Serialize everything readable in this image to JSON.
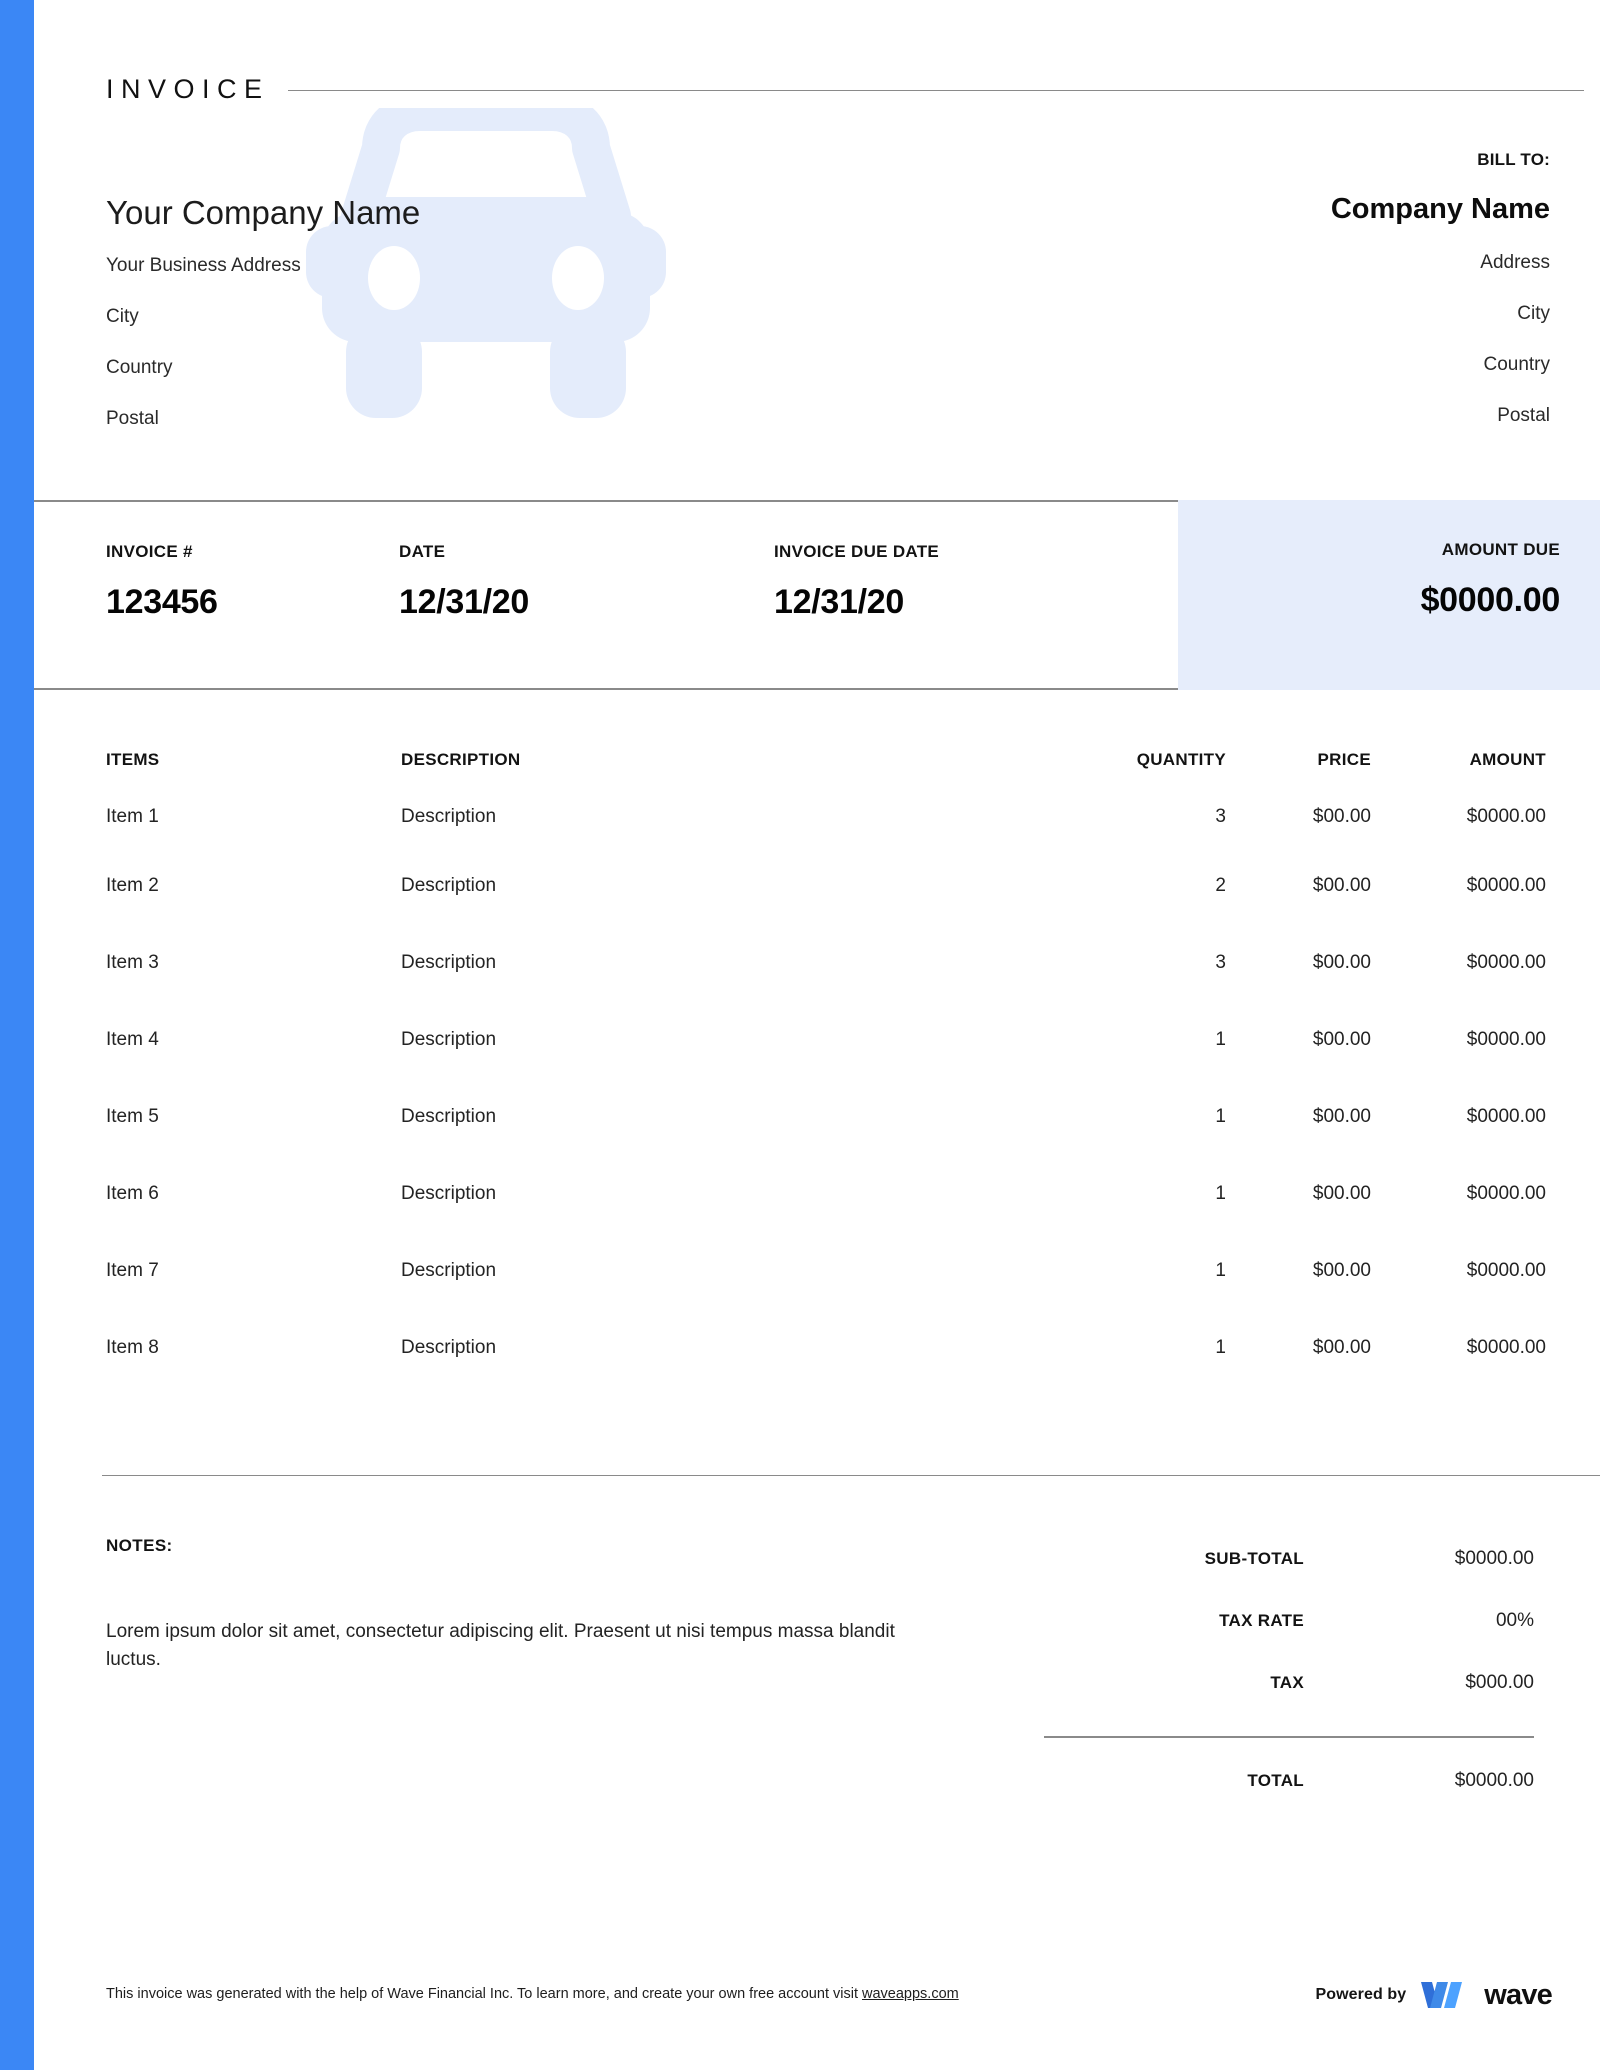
{
  "document": {
    "title": "INVOICE"
  },
  "sender": {
    "company_name": "Your Company Name",
    "address_lines": [
      "Your Business Address",
      "City",
      "Country",
      "Postal"
    ]
  },
  "bill_to": {
    "label": "BILL TO:",
    "company_name": "Company Name",
    "address_lines": [
      "Address",
      "City",
      "Country",
      "Postal"
    ]
  },
  "meta": {
    "invoice_number_label": "INVOICE #",
    "invoice_number": "123456",
    "date_label": "DATE",
    "date": "12/31/20",
    "due_date_label": "INVOICE DUE DATE",
    "due_date": "12/31/20",
    "amount_due_label": "AMOUNT DUE",
    "amount_due": "$0000.00"
  },
  "items_table": {
    "headers": [
      "ITEMS",
      "DESCRIPTION",
      "QUANTITY",
      "PRICE",
      "AMOUNT"
    ],
    "rows": [
      {
        "item": "Item 1",
        "description": "Description",
        "quantity": "3",
        "price": "$00.00",
        "amount": "$0000.00"
      },
      {
        "item": "Item 2",
        "description": "Description",
        "quantity": "2",
        "price": "$00.00",
        "amount": "$0000.00"
      },
      {
        "item": "Item 3",
        "description": "Description",
        "quantity": "3",
        "price": "$00.00",
        "amount": "$0000.00"
      },
      {
        "item": "Item 4",
        "description": "Description",
        "quantity": "1",
        "price": "$00.00",
        "amount": "$0000.00"
      },
      {
        "item": "Item 5",
        "description": "Description",
        "quantity": "1",
        "price": "$00.00",
        "amount": "$0000.00"
      },
      {
        "item": "Item 6",
        "description": "Description",
        "quantity": "1",
        "price": "$00.00",
        "amount": "$0000.00"
      },
      {
        "item": "Item 7",
        "description": "Description",
        "quantity": "1",
        "price": "$00.00",
        "amount": "$0000.00"
      },
      {
        "item": "Item 8",
        "description": "Description",
        "quantity": "1",
        "price": "$00.00",
        "amount": "$0000.00"
      }
    ]
  },
  "notes": {
    "label": "NOTES:",
    "text": "Lorem ipsum dolor sit amet, consectetur adipiscing elit. Praesent ut nisi tempus massa blandit luctus."
  },
  "totals": {
    "subtotal_label": "SUB-TOTAL",
    "subtotal_value": "$0000.00",
    "tax_rate_label": "TAX RATE",
    "tax_rate_value": "00%",
    "tax_label": "TAX",
    "tax_value": "$000.00",
    "total_label": "TOTAL",
    "total_value": "$0000.00"
  },
  "footer": {
    "text_before_link": "This invoice was generated with the help of Wave Financial Inc. To learn more, and create your own free account visit ",
    "link_text": "waveapps.com",
    "powered_by_label": "Powered by",
    "brand_name": "wave"
  },
  "colors": {
    "accent_stripe": "#3b87f5",
    "amount_due_panel": "#e6edfb",
    "watermark": "#e4ecfb",
    "rule": "#8a8a8a",
    "brand_blue_dark": "#2f6fd8",
    "brand_blue_light": "#4da2ff"
  }
}
